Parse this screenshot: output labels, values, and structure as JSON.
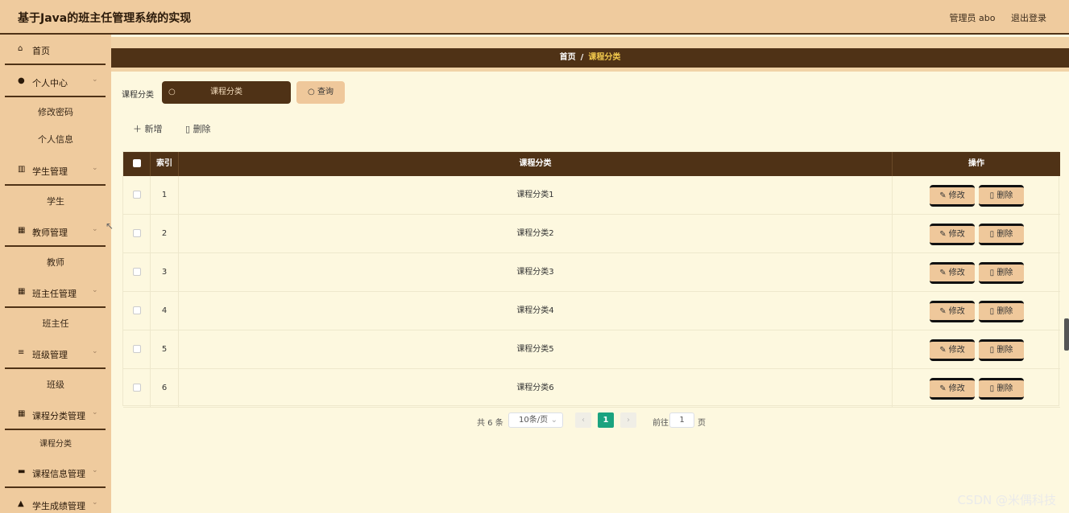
{
  "header": {
    "title": "基于Java的班主任管理系统的实现",
    "user_label": "管理员 abo",
    "logout_label": "退出登录"
  },
  "sidebar": {
    "items": [
      {
        "label": "首页",
        "icon": "home-icon"
      },
      {
        "label": "个人中心",
        "icon": "user-icon",
        "sub": [
          "修改密码",
          "个人信息"
        ]
      },
      {
        "label": "学生管理",
        "icon": "bar-chart-icon",
        "sub": [
          "学生"
        ]
      },
      {
        "label": "教师管理",
        "icon": "grid-icon",
        "sub": [
          "教师"
        ]
      },
      {
        "label": "班主任管理",
        "icon": "grid-icon",
        "sub": [
          "班主任"
        ]
      },
      {
        "label": "班级管理",
        "icon": "list-icon",
        "sub": [
          "班级"
        ]
      },
      {
        "label": "课程分类管理",
        "icon": "grid-icon",
        "sub": [
          "课程分类"
        ]
      },
      {
        "label": "课程信息管理",
        "icon": "briefcase-icon"
      },
      {
        "label": "学生成绩管理",
        "icon": "thumb-icon"
      }
    ]
  },
  "breadcrumb": {
    "home": "首页",
    "current": "课程分类"
  },
  "search": {
    "label": "课程分类",
    "placeholder": "课程分类",
    "button": "查询"
  },
  "actions": {
    "add": "新增",
    "delete": "删除"
  },
  "table": {
    "columns": [
      "索引",
      "课程分类",
      "操作"
    ],
    "rows": [
      {
        "index": "1",
        "name": "课程分类1"
      },
      {
        "index": "2",
        "name": "课程分类2"
      },
      {
        "index": "3",
        "name": "课程分类3"
      },
      {
        "index": "4",
        "name": "课程分类4"
      },
      {
        "index": "5",
        "name": "课程分类5"
      },
      {
        "index": "6",
        "name": "课程分类6"
      }
    ],
    "edit_label": "修改",
    "delete_label": "删除"
  },
  "pagination": {
    "total": "共 6 条",
    "page_size": "10条/页",
    "current_page": "1",
    "goto_label": "前往",
    "goto_value": "1",
    "unit": "页"
  },
  "watermark": "CSDN @米偶科技",
  "colors": {
    "header": "#efcb9e",
    "dark": "#4f3216",
    "background": "#fdf8df",
    "accent": "#f2c94c",
    "page_active": "#1aa37f"
  }
}
